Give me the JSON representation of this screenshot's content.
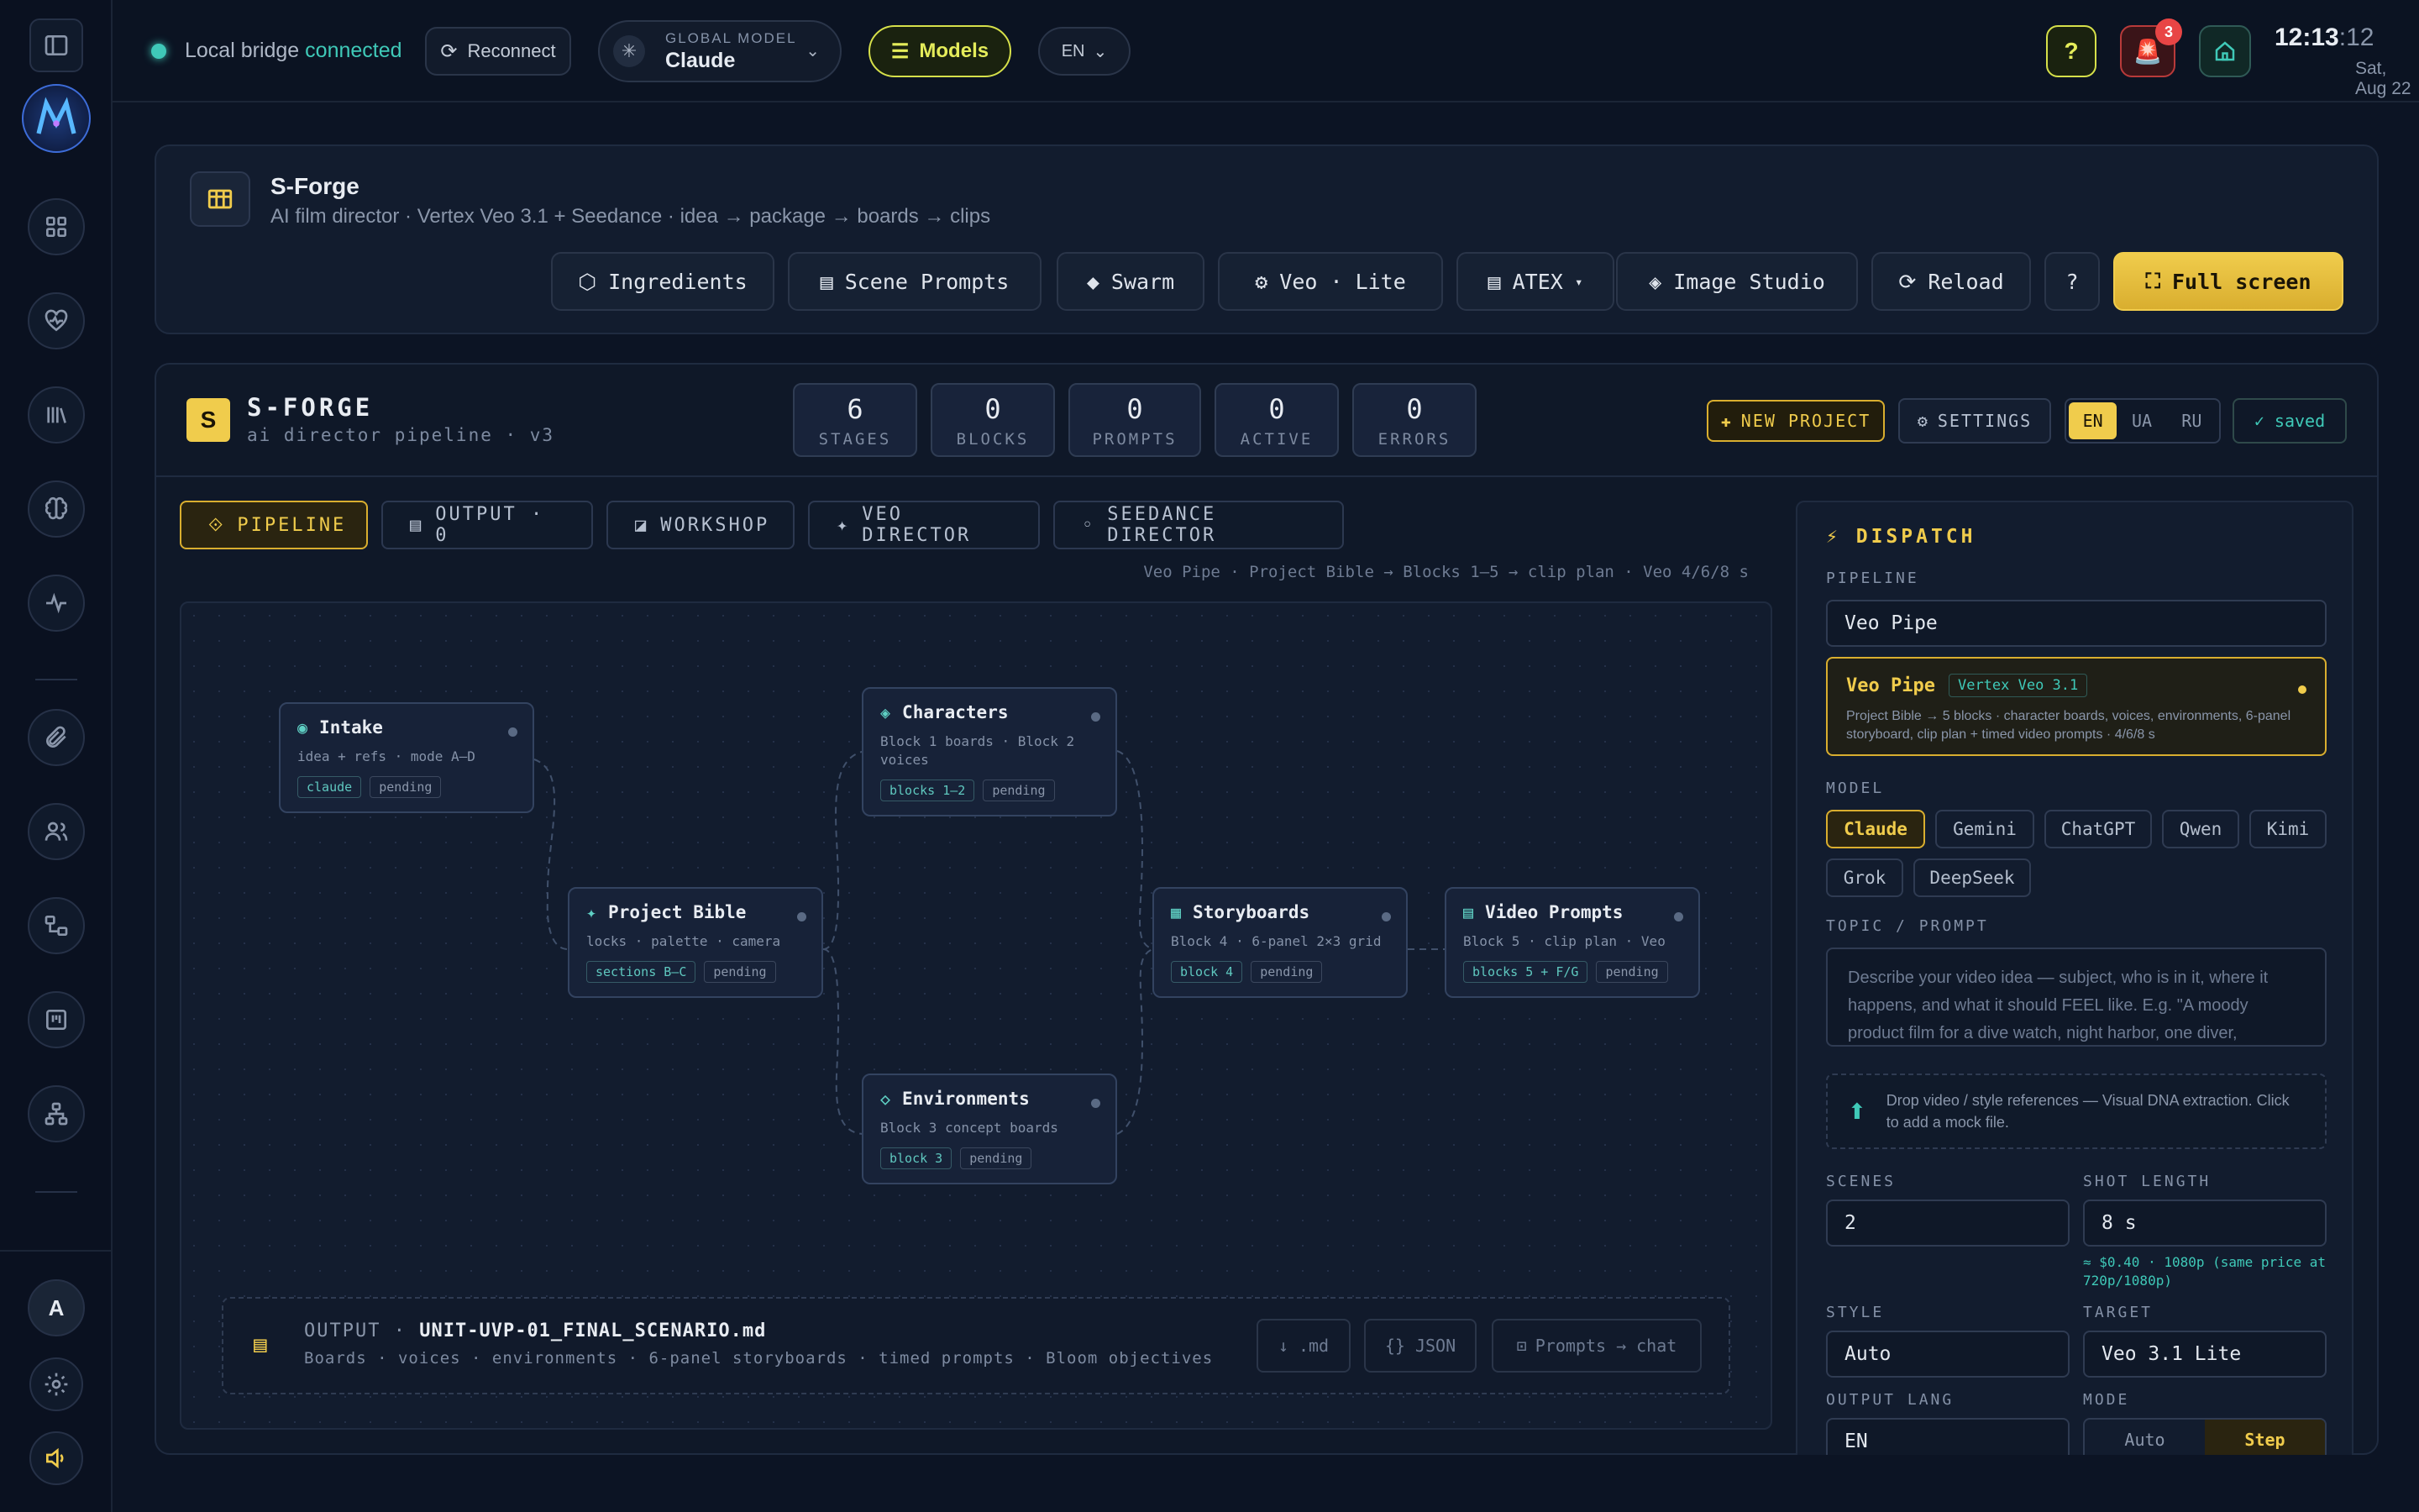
{
  "topbar": {
    "bridge_label": "Local bridge",
    "bridge_status": "connected",
    "reconnect": "Reconnect",
    "global_model_label": "GLOBAL MODEL",
    "global_model": "Claude",
    "models": "Models",
    "lang": "EN",
    "help": "?",
    "alert_count": "3",
    "clock_hm": "12:13",
    "clock_s": ":12",
    "date": "Sat, Aug 22"
  },
  "header": {
    "title": "S-Forge",
    "subtitle": "AI film director · Vertex Veo 3.1 + Seedance · idea → package → boards → clips",
    "buttons": [
      "Ingredients",
      "Scene Prompts",
      "Swarm",
      "Veo · Lite",
      "ATEX",
      "Image Studio",
      "Reload",
      "?"
    ],
    "fullscreen": "Full screen"
  },
  "forge": {
    "logo": "S",
    "title": "S-FORGE",
    "subtitle": "ai director pipeline · v3",
    "stats": [
      {
        "value": "6",
        "label": "STAGES"
      },
      {
        "value": "0",
        "label": "BLOCKS"
      },
      {
        "value": "0",
        "label": "PROMPTS"
      },
      {
        "value": "0",
        "label": "ACTIVE"
      },
      {
        "value": "0",
        "label": "ERRORS"
      }
    ],
    "new_project": "NEW PROJECT",
    "settings": "SETTINGS",
    "langs": [
      "EN",
      "UA",
      "RU"
    ],
    "saved": "✓ saved"
  },
  "tabs": [
    "PIPELINE",
    "OUTPUT · 0",
    "WORKSHOP",
    "VEO DIRECTOR",
    "SEEDANCE DIRECTOR"
  ],
  "breadcrumb": "Veo Pipe · Project Bible → Blocks 1–5 → clip plan · Veo 4/6/8 s",
  "nodes": {
    "intake": {
      "title": "Intake",
      "sub": "idea + refs · mode A–D",
      "tags": [
        "claude",
        "pending"
      ]
    },
    "characters": {
      "title": "Characters",
      "sub": "Block 1 boards · Block 2 voices",
      "tags": [
        "blocks 1–2",
        "pending"
      ]
    },
    "bible": {
      "title": "Project Bible",
      "sub": "locks · palette · camera",
      "tags": [
        "sections B–C",
        "pending"
      ]
    },
    "storyboards": {
      "title": "Storyboards",
      "sub": "Block 4 · 6-panel 2×3 grid",
      "tags": [
        "block 4",
        "pending"
      ]
    },
    "videoprompts": {
      "title": "Video Prompts",
      "sub": "Block 5 · clip plan · Veo",
      "tags": [
        "blocks 5 + F/G",
        "pending"
      ]
    },
    "environments": {
      "title": "Environments",
      "sub": "Block 3 concept boards",
      "tags": [
        "block 3",
        "pending"
      ]
    }
  },
  "output": {
    "label": "OUTPUT",
    "file": "UNIT-UVP-01_FINAL_SCENARIO.md",
    "desc": "Boards · voices · environments · 6-panel storyboards · timed prompts · Bloom objectives",
    "md": "↓ .md",
    "json": "{} JSON",
    "chat": "Prompts → chat"
  },
  "dispatch": {
    "title": "DISPATCH",
    "pipeline_label": "PIPELINE",
    "pipeline_value": "Veo Pipe",
    "card_title": "Veo Pipe",
    "card_badge": "Vertex Veo 3.1",
    "card_desc": "Project Bible → 5 blocks · character boards, voices, environments, 6-panel storyboard, clip plan + timed video prompts · 4/6/8 s",
    "model_label": "MODEL",
    "models": [
      "Claude",
      "Gemini",
      "ChatGPT",
      "Qwen",
      "Kimi",
      "Grok",
      "DeepSeek"
    ],
    "topic_label": "TOPIC / PROMPT",
    "topic_placeholder": "Describe your video idea — subject, who is in it, where it happens, and what it should FEEL like. E.g. \"A moody product film for a dive watch, night harbor, one diver,",
    "drop_text": "Drop video / style references — Visual DNA extraction. Click to add a mock file.",
    "scenes_label": "SCENES",
    "scenes_value": "2",
    "shot_label": "SHOT LENGTH",
    "shot_value": "8 s",
    "price_note": "≈ $0.40 · 1080p (same price at 720p/1080p)",
    "style_label": "STYLE",
    "style_value": "Auto",
    "target_label": "TARGET",
    "target_value": "Veo 3.1 Lite",
    "outlang_label": "OUTPUT LANG",
    "outlang_value": "EN",
    "mode_label": "MODE",
    "modes": [
      "Auto",
      "Step"
    ]
  },
  "user": {
    "avatar": "A"
  },
  "colors": {
    "accent": "#f0cc4c",
    "teal": "#3fc9b8",
    "bg": "#0c1424"
  }
}
